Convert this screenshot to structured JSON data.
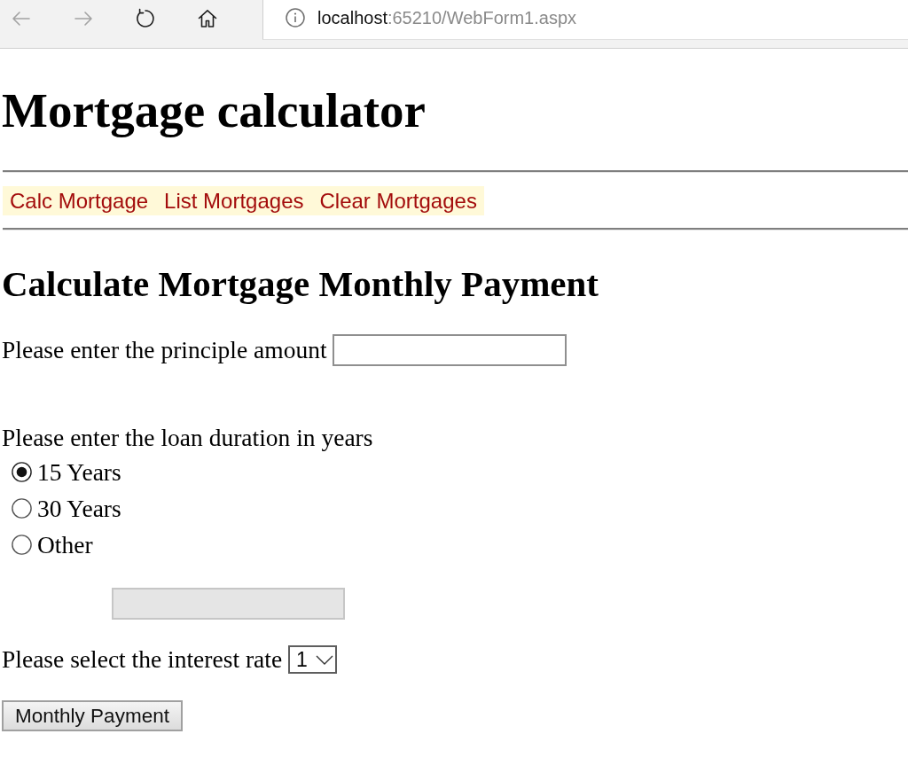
{
  "browser": {
    "back": {
      "disabled": true
    },
    "forward": {
      "disabled": true
    },
    "url": {
      "host": "localhost",
      "path": ":65210/WebForm1.aspx"
    }
  },
  "title": "Mortgage calculator",
  "menu": [
    {
      "label": "Calc Mortgage"
    },
    {
      "label": "List Mortgages"
    },
    {
      "label": "Clear Mortgages"
    }
  ],
  "section_title": "Calculate Mortgage Monthly Payment",
  "principal": {
    "label": "Please enter the principle amount"
  },
  "duration": {
    "label": "Please enter the loan duration in years",
    "options": [
      {
        "label": "15 Years",
        "selected": true
      },
      {
        "label": "30 Years",
        "selected": false
      },
      {
        "label": "Other",
        "selected": false
      }
    ],
    "other_field": {
      "disabled": true
    }
  },
  "interest": {
    "label": "Please select the interest rate",
    "value": "1"
  },
  "submit": {
    "label": "Monthly Payment"
  }
}
